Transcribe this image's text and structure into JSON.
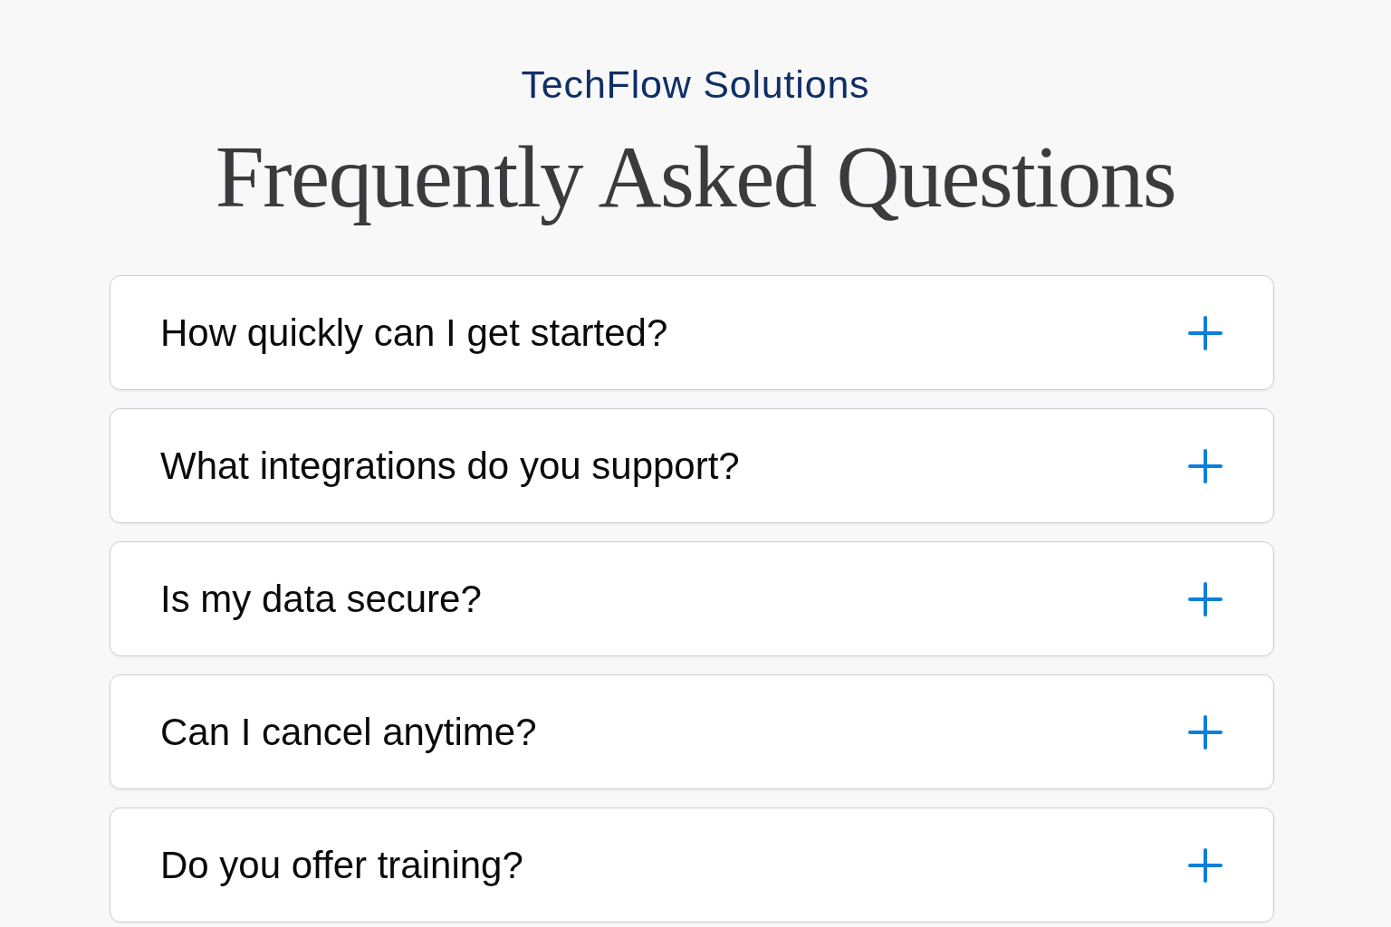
{
  "header": {
    "brand": "TechFlow Solutions",
    "title": "Frequently Asked Questions"
  },
  "faqs": [
    {
      "question": "How quickly can I get started?",
      "expanded": false
    },
    {
      "question": "What integrations do you support?",
      "expanded": false
    },
    {
      "question": "Is my data secure?",
      "expanded": false
    },
    {
      "question": "Can I cancel anytime?",
      "expanded": false
    },
    {
      "question": "Do you offer training?",
      "expanded": false
    }
  ]
}
